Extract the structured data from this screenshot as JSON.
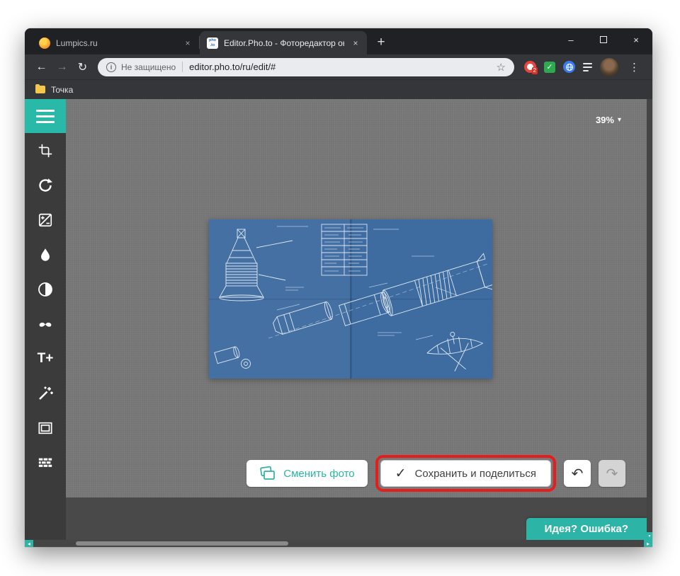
{
  "glyphs": {
    "close": "×",
    "minimize": "–",
    "plus": "+",
    "back": "←",
    "forward": "→",
    "reload": "↻",
    "info": "i",
    "star": "☆",
    "kebab": "⋮",
    "undo": "↶",
    "redo": "↷",
    "caret_down": "▾",
    "check": "✓",
    "ext_check": "✓",
    "scroll_left": "◂",
    "scroll_right": "▸",
    "scroll_down": "▾",
    "text_tool": "T+"
  },
  "browser": {
    "tabs": [
      {
        "title": "Lumpics.ru"
      },
      {
        "title": "Editor.Pho.to - Фоторедактор он"
      }
    ],
    "favicon_photo": {
      "line1": "pho",
      "line2": ".to"
    },
    "address": {
      "security": "Не защищено",
      "url": "editor.pho.to/ru/edit/#"
    },
    "extension_badge": "2",
    "bookmark": "Точка"
  },
  "editor": {
    "zoom": "39%",
    "buttons": {
      "change_photo": "Сменить фото",
      "save_share": "Сохранить и поделиться",
      "feedback": "Идея? Ошибка?"
    }
  },
  "colors": {
    "teal": "#2cb5a6",
    "annotation_red": "#e41d1d",
    "blueprint_blue": "#3e6ba0"
  }
}
